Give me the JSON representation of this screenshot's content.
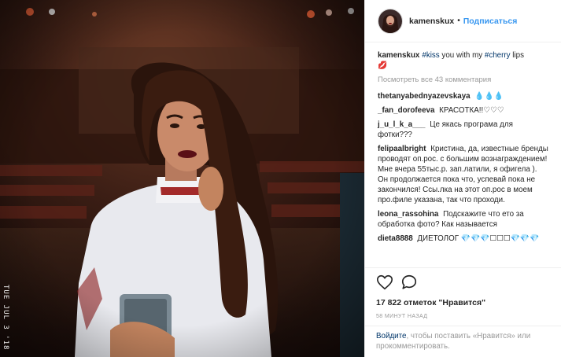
{
  "post": {
    "username": "kamenskux",
    "follow_label": "Подписаться",
    "caption_user": "kamenskux",
    "caption_tag1": "#kiss",
    "caption_mid": " you with my ",
    "caption_tag2": "#cherry",
    "caption_end": " lips",
    "caption_emoji": "💋",
    "view_all": "Посмотреть все 43 комментария",
    "likes": "17 822 отметок \"Нравится\"",
    "time": "58 МИНУТ НАЗАД",
    "photo_datestamp": "TUE JUL 3 '18"
  },
  "comments": [
    {
      "user": "thetanyabednyazevskaya",
      "text": "💧💧💧"
    },
    {
      "user": "_fan_dorofeeva",
      "text": "КРАСОТКА!!♡♡♡"
    },
    {
      "user": "j_u_l_k_a___",
      "text": "Це якась програма для фотки???"
    },
    {
      "user": "felipaalbright",
      "text": "Кристина, да, известные бренды проводят оп.рос. с большим вознаграждением! Мне вчера 55тыс.р. зап.латили, я офигела ). Он продолжается пока что, успевай пока не закончился! Ссы.лка на этот оп.рос в моем про.филе указана, так что проходи."
    },
    {
      "user": "leona_rassohina",
      "text": "Подскажите что ето за обработка фото? Как называется"
    },
    {
      "user": "dieta8888",
      "text": "ДИЕТОЛОГ 💎💎💎☐☐☐💎💎💎"
    }
  ],
  "footer": {
    "login_label": "Войдите",
    "rest": ", чтобы поставить «Нравится» или прокомментировать."
  },
  "colors": {
    "link_blue": "#3897f0",
    "hashtag": "#003569",
    "meta_grey": "#999999",
    "border": "#efefef"
  }
}
